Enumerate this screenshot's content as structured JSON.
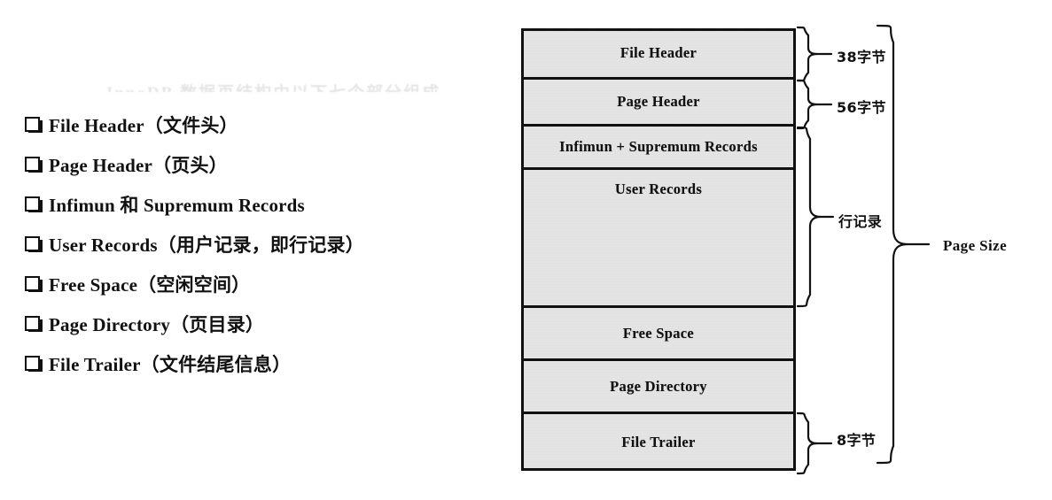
{
  "figure": {
    "title_ghost": "InnoDB 数据页结构由以下七个部分组成",
    "bullets": [
      {
        "label": "File Header（文件头）"
      },
      {
        "label": "Page Header（页头）"
      },
      {
        "label": "Infimun 和 Supremum Records"
      },
      {
        "label": "User Records（用户记录，即行记录）"
      },
      {
        "label": "Free Space（空闲空间）"
      },
      {
        "label": "Page Directory（页目录）"
      },
      {
        "label": "File Trailer（文件结尾信息）"
      }
    ],
    "checkbox_icon": "checkbox-square-icon"
  },
  "diagram": {
    "segments": [
      {
        "name": "file-header",
        "label": "File Header"
      },
      {
        "name": "page-header",
        "label": "Page Header"
      },
      {
        "name": "infimum-supremum",
        "label": "Infimun + Supremum Records"
      },
      {
        "name": "user-records",
        "label": "User Records"
      },
      {
        "name": "free-space",
        "label": "Free Space"
      },
      {
        "name": "page-directory",
        "label": "Page Directory"
      },
      {
        "name": "file-trailer",
        "label": "File Trailer"
      }
    ],
    "annotations": [
      {
        "name": "file-header-size",
        "text": "38字节"
      },
      {
        "name": "page-header-size",
        "text": "56字节"
      },
      {
        "name": "row-records",
        "text": "行记录"
      },
      {
        "name": "file-trailer-size",
        "text": "8字节"
      },
      {
        "name": "page-size",
        "text": "Page Size"
      }
    ]
  },
  "colors": {
    "box_fill": "#e9e9e9",
    "stroke": "#111111",
    "page_bg": "#ffffff"
  }
}
